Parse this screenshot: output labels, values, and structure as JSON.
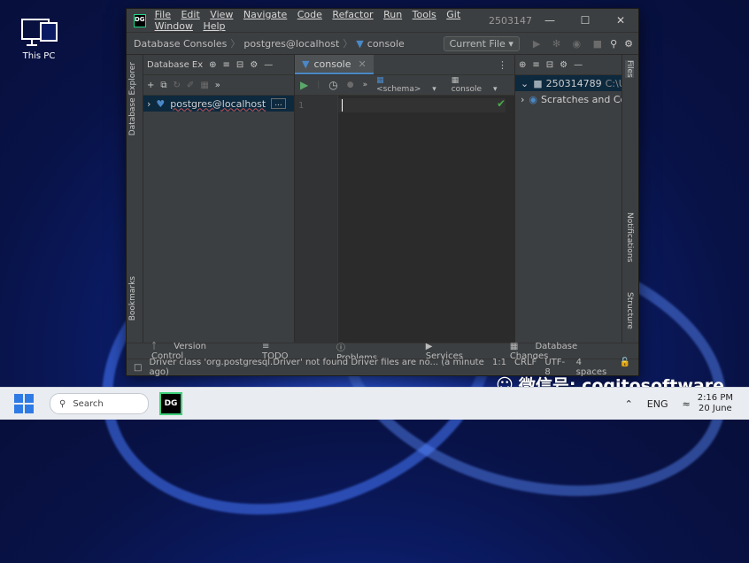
{
  "desktop": {
    "icon_label": "This PC"
  },
  "titlebar": {
    "menu": [
      "File",
      "Edit",
      "View",
      "Navigate",
      "Code",
      "Refactor",
      "Run",
      "Tools",
      "Git",
      "Window",
      "Help"
    ],
    "window_title": "2503147"
  },
  "navbar": {
    "crumbs": [
      "Database Consoles",
      "postgres@localhost",
      "console"
    ],
    "current_file": "Current File"
  },
  "db_explorer": {
    "title": "Database Ex",
    "tree": [
      {
        "label": "postgres@localhost",
        "badge": "..."
      }
    ]
  },
  "left_stripe": {
    "explorer": "Database Explorer",
    "bookmarks": "Bookmarks"
  },
  "editor": {
    "tab": "console",
    "schema": "<schema>",
    "console_sel": "console",
    "line_numbers": [
      "1"
    ]
  },
  "right_panel": {
    "rows": [
      {
        "label": "250314789",
        "sub": "C:\\User"
      },
      {
        "label": "Scratches and Con",
        "sub": ""
      }
    ]
  },
  "right_stripe": {
    "files": "Files",
    "notifications": "Notifications",
    "structure": "Structure"
  },
  "tool_windows": [
    "Version Control",
    "TODO",
    "Problems",
    "Services",
    "Database Changes"
  ],
  "status": {
    "message": "Driver class 'org.postgresql.Driver' not found Driver files are no... (a minute ago)",
    "position": "1:1",
    "line_sep": "CRLF",
    "encoding": "UTF-8",
    "indent": "4 spaces"
  },
  "taskbar": {
    "search": "Search",
    "lang": "ENG",
    "time": "2:16 PM",
    "date": "20 June"
  },
  "watermark": "微信号: cogitosoftware"
}
